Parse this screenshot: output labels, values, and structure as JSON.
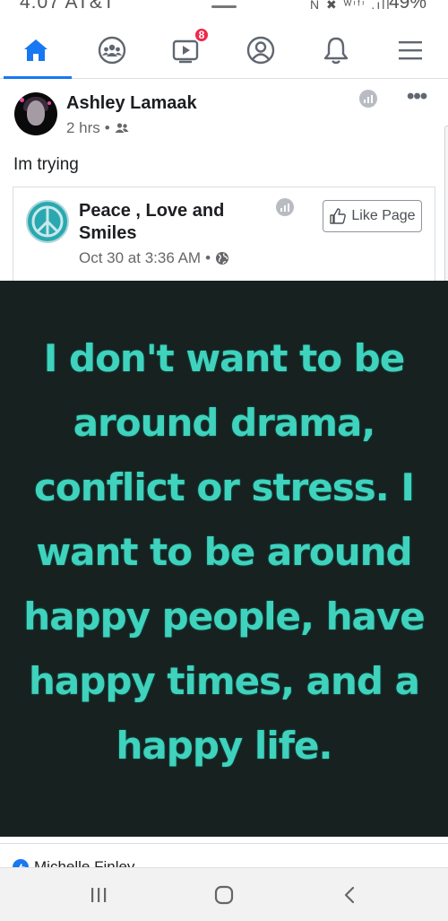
{
  "status_bar": {
    "time": "4:07 AT&T",
    "signal_icons": "N ✖ ᵂⁱᶠⁱ .ıll",
    "battery": "49%"
  },
  "nav": {
    "tabs": [
      {
        "name": "home",
        "active": true
      },
      {
        "name": "groups",
        "active": false
      },
      {
        "name": "watch",
        "badge": "8",
        "active": false
      },
      {
        "name": "profile",
        "active": false
      },
      {
        "name": "notifications",
        "active": false
      },
      {
        "name": "menu",
        "active": false
      }
    ],
    "accent_color": "#1877f2"
  },
  "post": {
    "author": "Ashley Lamaak",
    "time": "2 hrs",
    "audience_icon": "friends-icon",
    "text": "Im trying",
    "more_label": "•••"
  },
  "shared": {
    "page_name": "Peace , Love and Smiles",
    "date": "Oct 30 at 3:36 AM",
    "audience_icon": "globe-icon",
    "like_page_label": "Like Page"
  },
  "image": {
    "quote": "I don't want to be around drama, conflict or stress. I want to be around happy people, have happy times, and a happy life.",
    "quote_lines": [
      "I don't want to be",
      "around drama,",
      "conflict or stress. I",
      "want to be around",
      "happy people, have",
      "happy times, and a",
      "happy life."
    ],
    "text_color": "#3fd2bd",
    "background_color": "#17211f"
  },
  "reactions": {
    "first_reactor": "Michelle Finley"
  }
}
